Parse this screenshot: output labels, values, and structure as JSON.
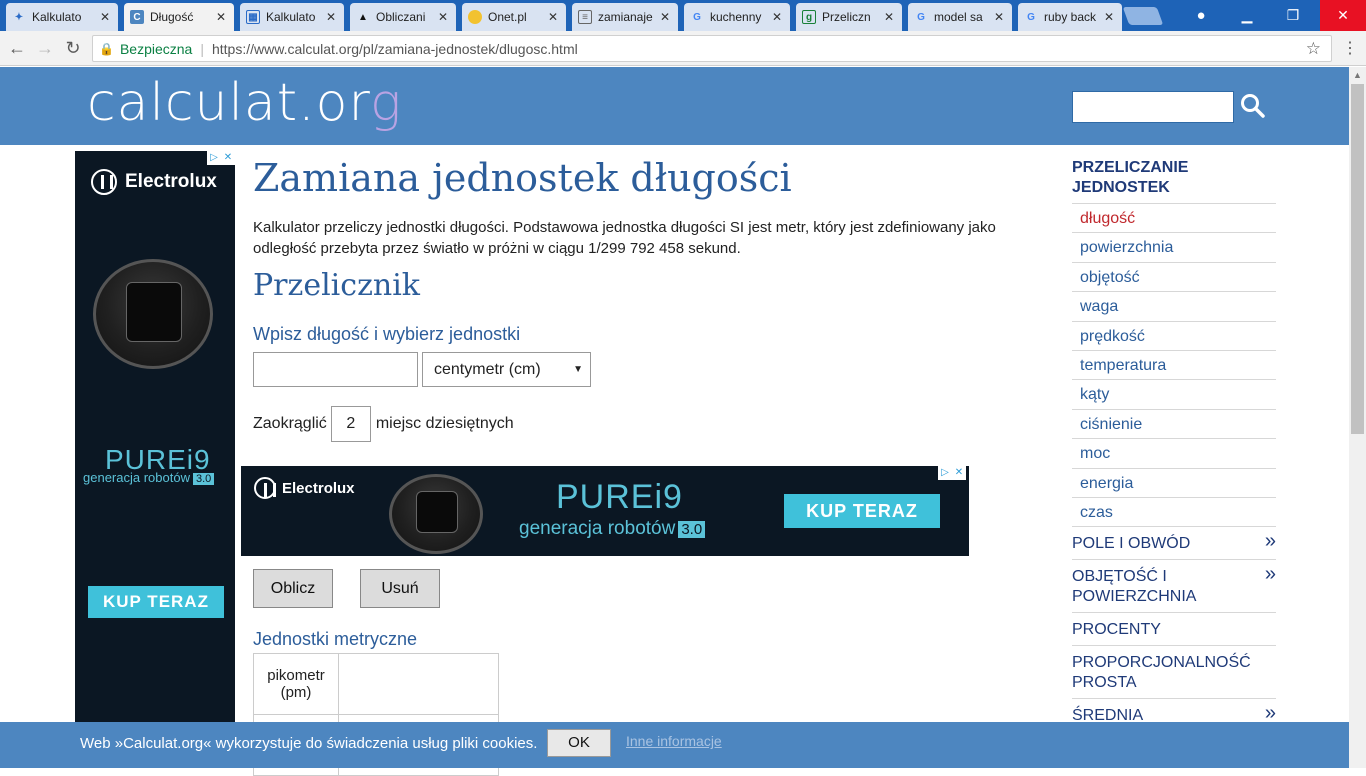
{
  "browser": {
    "tabs": [
      {
        "title": "Kalkulato",
        "favicon": "blue-wing"
      },
      {
        "title": "Długość",
        "favicon": "calculat-c"
      },
      {
        "title": "Kalkulato",
        "favicon": "grid"
      },
      {
        "title": "Obliczani",
        "favicon": "cap"
      },
      {
        "title": "Onet.pl",
        "favicon": "yellow-dot"
      },
      {
        "title": "zamianaje",
        "favicon": "doc"
      },
      {
        "title": "kuchenny",
        "favicon": "google-g"
      },
      {
        "title": "Przeliczn",
        "favicon": "green-doc"
      },
      {
        "title": "model sa",
        "favicon": "google-g"
      },
      {
        "title": "ruby back",
        "favicon": "google-g"
      }
    ],
    "secure_label": "Bezpieczna",
    "url": "https://www.calculat.org/pl/zamiana-jednostek/dlugosc.html"
  },
  "header": {
    "logo_main": "calculat.or",
    "logo_g": "g",
    "search_placeholder": ""
  },
  "main": {
    "title": "Zamiana jednostek długości",
    "intro": "Kalkulator przeliczy jednostki długości. Podstawowa jednostka długości SI jest metr, który jest zdefiniowany jako odległość przebyta przez światło w próżni w ciągu 1/299 792 458 sekund.",
    "converter_title": "Przelicznik",
    "input_prompt": "Wpisz długość i wybierz jednostki",
    "length_value": "",
    "unit_selected": "centymetr (cm)",
    "round_label_before": "Zaokrąglić",
    "round_value": "2",
    "round_label_after": "miejsc dziesiętnych",
    "calc_button": "Oblicz",
    "clear_button": "Usuń",
    "metric_title": "Jednostki metryczne",
    "metric_rows": [
      {
        "unit": "pikometr (pm)",
        "value": ""
      },
      {
        "unit": "",
        "value": ""
      }
    ]
  },
  "ads": {
    "brand": "Electrolux",
    "product": "PUREi9",
    "tagline": "generacja robotów",
    "version": "3.0",
    "cta": "KUP TERAZ",
    "adchoice_icon": "adchoices-icon",
    "close_icon": "close-icon"
  },
  "sidebar": {
    "heading": "PRZELICZANIE JEDNOSTEK",
    "items": [
      {
        "label": "długość",
        "active": true
      },
      {
        "label": "powierzchnia"
      },
      {
        "label": "objętość"
      },
      {
        "label": "waga"
      },
      {
        "label": "prędkość"
      },
      {
        "label": "temperatura"
      },
      {
        "label": "kąty"
      },
      {
        "label": "ciśnienie"
      },
      {
        "label": "moc"
      },
      {
        "label": "energia"
      },
      {
        "label": "czas"
      }
    ],
    "categories": [
      {
        "label": "POLE I OBWÓD",
        "expand": "»"
      },
      {
        "label": "OBJĘTOŚĆ I POWIERZCHNIA",
        "expand": "»"
      },
      {
        "label": "PROCENTY",
        "expand": ""
      },
      {
        "label": "PROPORCJONALNOŚĆ PROSTA",
        "expand": ""
      },
      {
        "label": "ŚREDNIA",
        "expand": "»"
      }
    ]
  },
  "cookie": {
    "text": "Web »Calculat.org« wykorzystuje do świadczenia usług pliki cookies.",
    "ok": "OK",
    "more": "Inne informacje"
  },
  "colors": {
    "header": "#4d86c0",
    "heading_blue": "#2c5d9a",
    "active_red": "#c0282d",
    "tab_bar": "#1e63b7"
  }
}
